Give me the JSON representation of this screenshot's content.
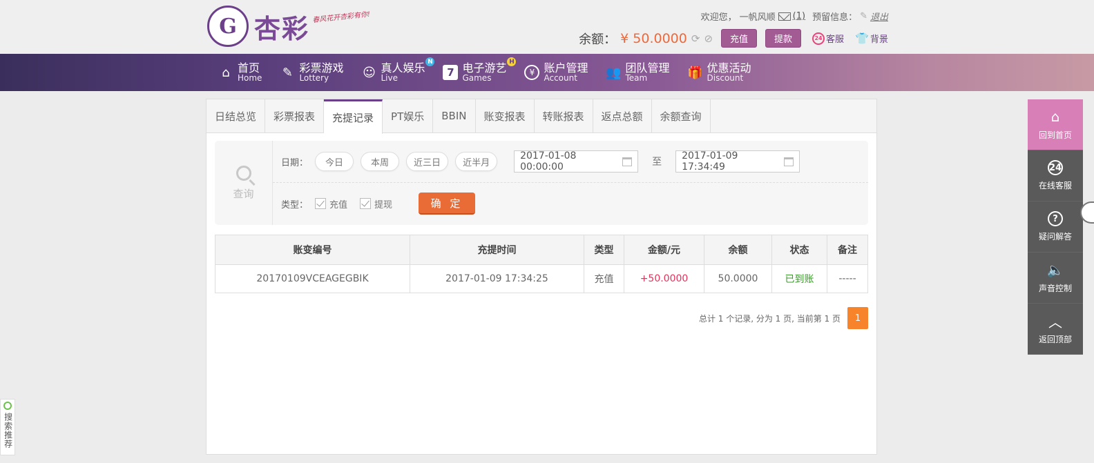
{
  "header": {
    "logo_text": "杏彩",
    "slogan": "春风花开杏彩有你!",
    "welcome": "欢迎您，",
    "username": "一帆风顺",
    "mail_count": "(1)",
    "reserve_info": "预留信息：",
    "logout": "退出",
    "balance_label": "余额：",
    "balance_amount": "¥ 50.0000",
    "recharge_btn": "充值",
    "withdraw_btn": "提款",
    "service": "客服",
    "background": "背景"
  },
  "nav": [
    {
      "cn": "首页",
      "en": "Home",
      "icon": "home-icon"
    },
    {
      "cn": "彩票游戏",
      "en": "Lottery",
      "icon": "lottery-icon"
    },
    {
      "cn": "真人娱乐",
      "en": "Live",
      "icon": "live-icon",
      "badge": "N"
    },
    {
      "cn": "电子游艺",
      "en": "Games",
      "icon": "seven-icon",
      "badge": "H"
    },
    {
      "cn": "账户管理",
      "en": "Account",
      "icon": "yen-icon"
    },
    {
      "cn": "团队管理",
      "en": "Team",
      "icon": "team-icon"
    },
    {
      "cn": "优惠活动",
      "en": "Discount",
      "icon": "gift-icon"
    }
  ],
  "tabs": [
    "日结总览",
    "彩票报表",
    "充提记录",
    "PT娱乐",
    "BBIN",
    "账变报表",
    "转账报表",
    "返点总额",
    "余额查询"
  ],
  "active_tab": "充提记录",
  "query": {
    "label": "查询",
    "date_label": "日期：",
    "quick": [
      "今日",
      "本周",
      "近三日",
      "近半月"
    ],
    "start": "2017-01-08 00:00:00",
    "to": "至",
    "end": "2017-01-09 17:34:49",
    "type_label": "类型：",
    "types": [
      "充值",
      "提现"
    ],
    "confirm": "确 定"
  },
  "table": {
    "headers": [
      "账变编号",
      "充提时间",
      "类型",
      "金额/元",
      "余额",
      "状态",
      "备注"
    ],
    "rows": [
      [
        "20170109VCEAGEGBIK",
        "2017-01-09 17:34:25",
        "充值",
        "+50.0000",
        "50.0000",
        "已到账",
        "-----"
      ]
    ]
  },
  "pager": {
    "summary": "总计 1 个记录, 分为 1 页, 当前第 1 页",
    "current": "1"
  },
  "sidebar": [
    "回到首页",
    "在线客服",
    "疑问解答",
    "声音控制",
    "返回顶部"
  ],
  "left_float": "搜索推荐",
  "colors": {
    "accent": "#6b3f8a",
    "confirm": "#e96b35",
    "positive": "#e6315a",
    "status_ok": "#3a9a2a",
    "page_active": "#f7842a"
  }
}
